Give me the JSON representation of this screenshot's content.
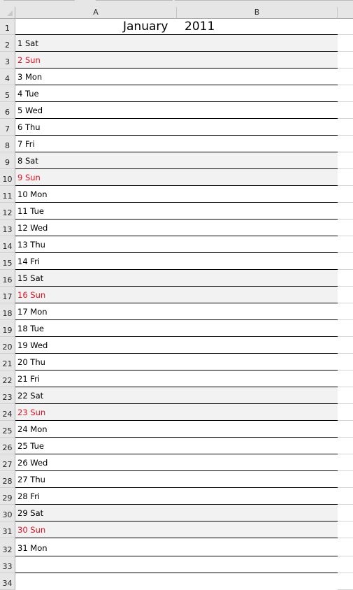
{
  "sheet": {
    "columns": [
      "A",
      "B",
      ""
    ],
    "title": {
      "month": "January",
      "year": "2011"
    },
    "row_numbers": [
      "1",
      "2",
      "3",
      "4",
      "5",
      "6",
      "7",
      "8",
      "9",
      "10",
      "11",
      "12",
      "13",
      "14",
      "15",
      "16",
      "17",
      "18",
      "19",
      "20",
      "21",
      "22",
      "23",
      "24",
      "25",
      "26",
      "27",
      "28",
      "29",
      "30",
      "31",
      "32",
      "33",
      "34"
    ],
    "days": [
      {
        "label": "1 Sat",
        "type": "sat"
      },
      {
        "label": "2 Sun",
        "type": "sun"
      },
      {
        "label": "3 Mon",
        "type": "weekday"
      },
      {
        "label": "4 Tue",
        "type": "weekday"
      },
      {
        "label": "5 Wed",
        "type": "weekday"
      },
      {
        "label": "6 Thu",
        "type": "weekday"
      },
      {
        "label": "7 Fri",
        "type": "weekday"
      },
      {
        "label": "8 Sat",
        "type": "sat"
      },
      {
        "label": "9 Sun",
        "type": "sun"
      },
      {
        "label": "10 Mon",
        "type": "weekday"
      },
      {
        "label": "11 Tue",
        "type": "weekday"
      },
      {
        "label": "12 Wed",
        "type": "weekday"
      },
      {
        "label": "13 Thu",
        "type": "weekday"
      },
      {
        "label": "14 Fri",
        "type": "weekday"
      },
      {
        "label": "15 Sat",
        "type": "sat"
      },
      {
        "label": "16 Sun",
        "type": "sun"
      },
      {
        "label": "17 Mon",
        "type": "weekday"
      },
      {
        "label": "18 Tue",
        "type": "weekday"
      },
      {
        "label": "19 Wed",
        "type": "weekday"
      },
      {
        "label": "20 Thu",
        "type": "weekday"
      },
      {
        "label": "21 Fri",
        "type": "weekday"
      },
      {
        "label": "22 Sat",
        "type": "sat"
      },
      {
        "label": "23 Sun",
        "type": "sun"
      },
      {
        "label": "24 Mon",
        "type": "weekday"
      },
      {
        "label": "25 Tue",
        "type": "weekday"
      },
      {
        "label": "26 Wed",
        "type": "weekday"
      },
      {
        "label": "27 Thu",
        "type": "weekday"
      },
      {
        "label": "28 Fri",
        "type": "weekday"
      },
      {
        "label": "29 Sat",
        "type": "sat"
      },
      {
        "label": "30 Sun",
        "type": "sun"
      },
      {
        "label": "31 Mon",
        "type": "weekday"
      }
    ],
    "colors": {
      "sunday_text": "#e81123",
      "weekend_fill": "#f2f2f2",
      "header_fill": "#e6e6e6"
    }
  }
}
